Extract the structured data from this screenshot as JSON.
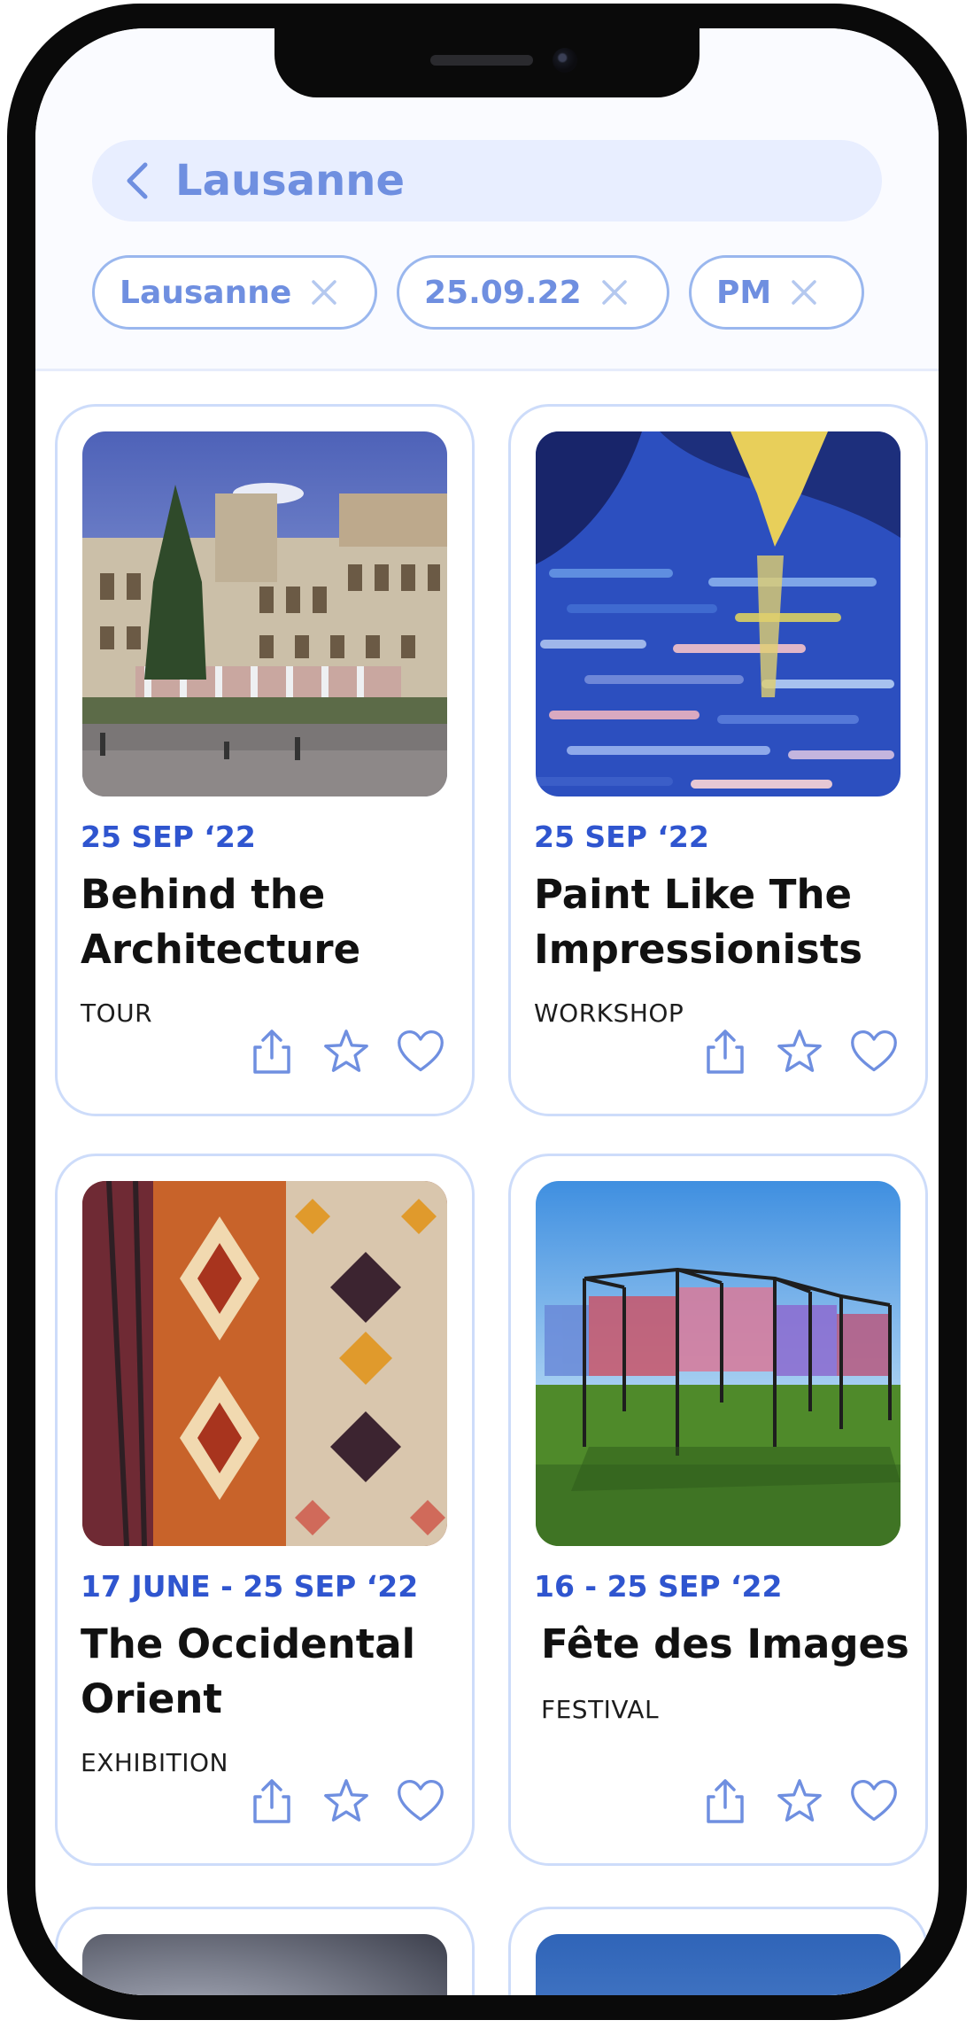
{
  "header": {
    "title": "Lausanne",
    "back_icon": "chevron-left-icon"
  },
  "filters": [
    {
      "label": "Lausanne"
    },
    {
      "label": "25.09.22"
    },
    {
      "label": "PM"
    }
  ],
  "events": [
    {
      "date": "25 SEP ‘22",
      "title": "Behind the Architecture",
      "type": "TOUR",
      "image": "palace-building-photo"
    },
    {
      "date": "25 SEP ‘22",
      "title": "Paint Like The Impressionists",
      "type": "WORKSHOP",
      "image": "impressionist-painting"
    },
    {
      "date": "17 JUNE - 25 SEP ‘22",
      "title": "The Occidental Orient",
      "type": "EXHIBITION",
      "image": "kilim-rugs-photo"
    },
    {
      "date": "16 - 25 SEP ‘22",
      "title": "Fête des Images",
      "type": "FESTIVAL",
      "image": "outdoor-installation-photo"
    }
  ],
  "card_actions": [
    "share-icon",
    "star-icon",
    "heart-icon"
  ],
  "colors": {
    "accent": "#6f8fe0",
    "date_blue": "#2f55cf",
    "chip_border": "#9ab7ee",
    "search_bg": "#e8eeff",
    "card_border": "#cddcfa"
  }
}
